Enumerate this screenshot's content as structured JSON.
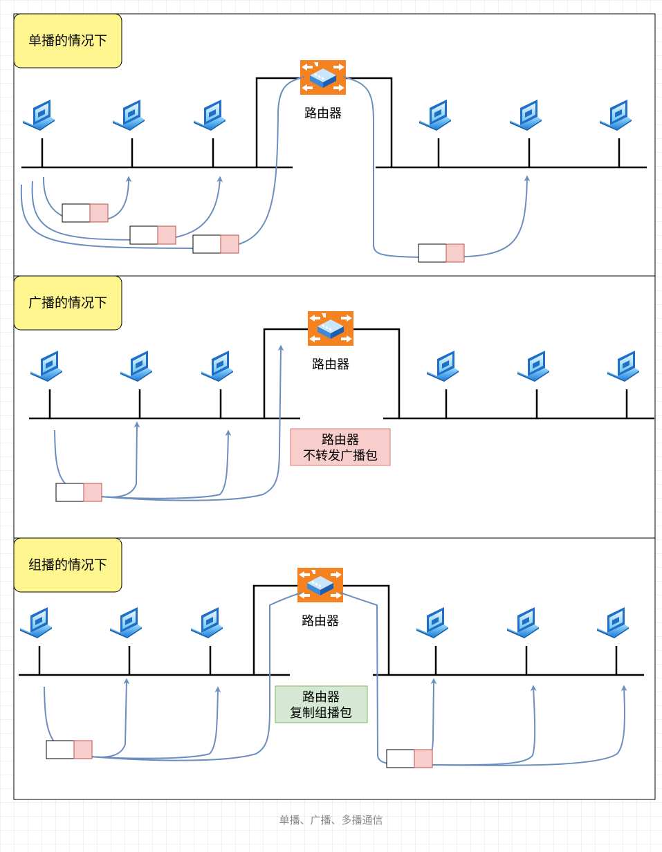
{
  "panels": [
    {
      "title": "单播的情况下",
      "router_label": "路由器",
      "notes": []
    },
    {
      "title": "广播的情况下",
      "router_label": "路由器",
      "notes": [
        {
          "lines": [
            "路由器",
            "不转发广播包"
          ]
        }
      ]
    },
    {
      "title": "组播的情况下",
      "router_label": "路由器",
      "notes": [
        {
          "lines": [
            "路由器",
            "复制组播包"
          ]
        }
      ]
    }
  ],
  "caption": "单播、广播、多播通信",
  "colors": {
    "title_fill": "#fff68f",
    "router_orange": "#f58220",
    "flow_line": "#6c8ebf",
    "packet_fill": "#f8cecc",
    "packet_stroke": "#b85450",
    "note_red_fill": "#f8cecc",
    "note_red_stroke": "#d77a7a",
    "note_green_fill": "#d5e8d4",
    "note_green_stroke": "#82b366",
    "cable": "#000000"
  },
  "icons": {
    "host": "laptop-icon",
    "router": "router-icon"
  }
}
